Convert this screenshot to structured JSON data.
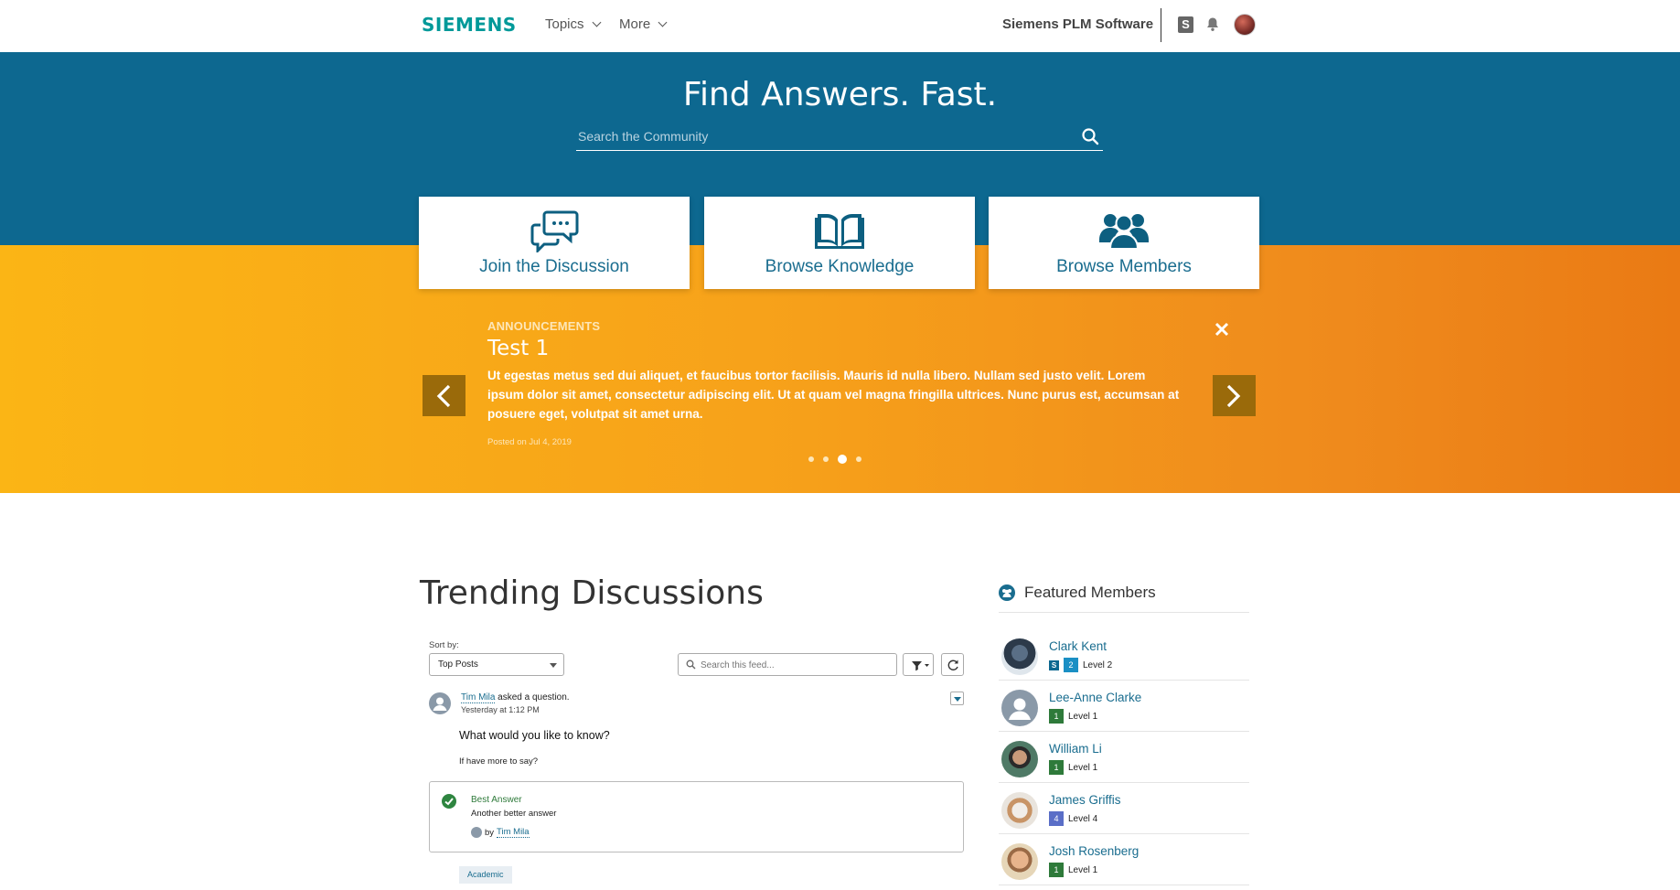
{
  "header": {
    "logo": "SIEMENS",
    "nav": [
      {
        "label": "Topics"
      },
      {
        "label": "More"
      }
    ],
    "brand_link": "Siemens PLM Software",
    "s_label": "S"
  },
  "hero": {
    "title": "Find Answers. Fast.",
    "search_placeholder": "Search the Community",
    "tiles": [
      {
        "label": "Join the Discussion",
        "icon": "chat-bubbles-icon"
      },
      {
        "label": "Browse Knowledge",
        "icon": "open-book-icon"
      },
      {
        "label": "Browse Members",
        "icon": "people-group-icon"
      }
    ]
  },
  "announcement": {
    "kicker": "ANNOUNCEMENTS",
    "title": "Test 1",
    "body": "Ut egestas metus sed dui aliquet, et faucibus tortor facilisis. Mauris id nulla libero. Nullam sed justo velit. Lorem ipsum dolor sit amet, consectetur adipiscing elit. Ut at quam vel magna fringilla ultrices. Nunc purus est, accumsan at posuere eget, volutpat sit amet urna.",
    "date": "Posted on Jul 4, 2019",
    "slide_count": 4,
    "active_slide": 3
  },
  "trending": {
    "title": "Trending Discussions",
    "sort_label": "Sort by:",
    "sort_value": "Top Posts",
    "search_placeholder": "Search this feed...",
    "post": {
      "author": "Tim Mila",
      "action": " asked a question.",
      "time": "Yesterday at 1:12 PM",
      "question": "What would you like to know?",
      "detail": "If have more to say?",
      "best_answer_label": "Best Answer",
      "best_answer_text": "Another better answer",
      "best_answer_by": "by",
      "best_answer_author": "Tim Mila",
      "topic": "Academic"
    }
  },
  "featured": {
    "title": "Featured Members",
    "members": [
      {
        "name": "Clark Kent",
        "badge": "2",
        "badge_color": "#1a8fc4",
        "level": "Level 2",
        "extra_badge": "S"
      },
      {
        "name": "Lee-Anne Clarke",
        "badge": "1",
        "badge_color": "#2e7a3a",
        "level": "Level 1"
      },
      {
        "name": "William Li",
        "badge": "1",
        "badge_color": "#2e7a3a",
        "level": "Level 1"
      },
      {
        "name": "James Griffis",
        "badge": "4",
        "badge_color": "#5a6ec7",
        "level": "Level 4"
      },
      {
        "name": "Josh Rosenberg",
        "badge": "1",
        "badge_color": "#2e7a3a",
        "level": "Level 1"
      }
    ]
  },
  "colors": {
    "brand_teal": "#009999",
    "hero_blue": "#0d6890",
    "hero_orange_start": "#fbb515",
    "hero_orange_end": "#ea7a14",
    "link": "#1a6d8f"
  }
}
